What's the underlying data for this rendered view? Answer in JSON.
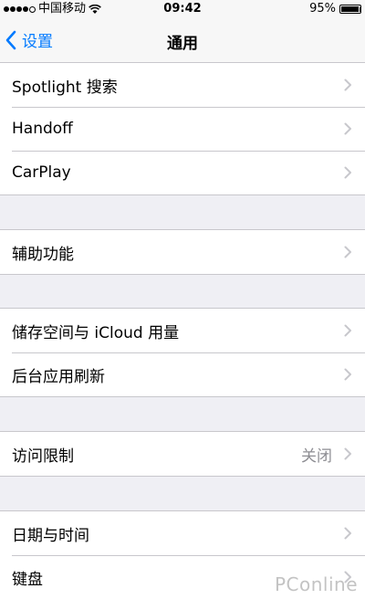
{
  "status_bar": {
    "carrier": "中国移动",
    "time": "09:42",
    "battery_percent": "95%",
    "battery_level": 0.95
  },
  "nav": {
    "back_label": "设置",
    "title": "通用"
  },
  "groups": [
    {
      "items": [
        {
          "label": "Spotlight 搜索"
        },
        {
          "label": "Handoff"
        },
        {
          "label": "CarPlay"
        }
      ]
    },
    {
      "items": [
        {
          "label": "辅助功能"
        }
      ]
    },
    {
      "items": [
        {
          "label": "储存空间与 iCloud 用量"
        },
        {
          "label": "后台应用刷新"
        }
      ]
    },
    {
      "items": [
        {
          "label": "访问限制",
          "value": "关闭"
        }
      ]
    },
    {
      "items": [
        {
          "label": "日期与时间"
        },
        {
          "label": "键盘"
        }
      ]
    }
  ],
  "watermark": "PConline",
  "colors": {
    "accent": "#007aff",
    "background": "#efeff4",
    "separator": "#c8c7cc"
  }
}
